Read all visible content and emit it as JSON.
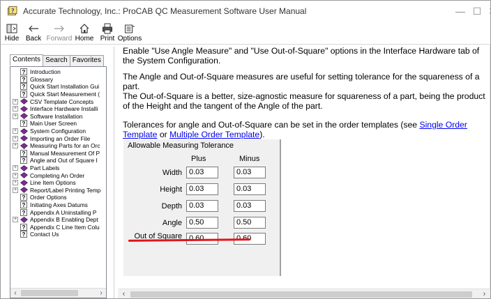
{
  "window": {
    "title": "Accurate Technology, Inc.: ProCAB QC Measurement Software User Manual",
    "minimize": "—",
    "maximize": "☐",
    "close": "✕"
  },
  "toolbar": {
    "hide": "Hide",
    "back": "Back",
    "forward": "Forward",
    "home": "Home",
    "print": "Print",
    "options": "Options"
  },
  "nav": {
    "tabs": [
      "Contents",
      "Search",
      "Favorites"
    ],
    "active_tab": "Contents",
    "tree": [
      {
        "type": "page",
        "label": "Introduction"
      },
      {
        "type": "page",
        "label": "Glossary"
      },
      {
        "type": "page",
        "label": "Quick Start Installation Gui"
      },
      {
        "type": "page",
        "label": "Quick Start Measurement ("
      },
      {
        "type": "book",
        "label": "CSV Template Concepts"
      },
      {
        "type": "book",
        "label": "Interface Hardware Installi"
      },
      {
        "type": "book",
        "label": "Software Installation"
      },
      {
        "type": "page",
        "label": "Main User Screen"
      },
      {
        "type": "book",
        "label": "System Configuration"
      },
      {
        "type": "book",
        "label": "Importing an Order File"
      },
      {
        "type": "book",
        "label": "Measuring Parts for an Orc"
      },
      {
        "type": "page",
        "label": "Manual Measurement Of P"
      },
      {
        "type": "page",
        "label": "Angle and Out of Square I"
      },
      {
        "type": "book",
        "label": "Part Labels"
      },
      {
        "type": "book",
        "label": "Completing An Order"
      },
      {
        "type": "book",
        "label": "Line Item Options"
      },
      {
        "type": "book",
        "label": "Report/Label Printing Temp"
      },
      {
        "type": "page",
        "label": "Order Options"
      },
      {
        "type": "page",
        "label": "Initiating Axes Datums"
      },
      {
        "type": "page",
        "label": "Appendix A  Uninstalling P"
      },
      {
        "type": "book",
        "label": "Appendix B  Enabling Dept"
      },
      {
        "type": "page",
        "label": "Appendix C  Line Item Colu"
      },
      {
        "type": "page",
        "label": "Contact Us"
      }
    ]
  },
  "content": {
    "para1": "Enable \"Use Angle Measure\" and \"Use Out-of-Square\" options in the Interface Hardware tab of the System Configuration.",
    "para2": "The Angle and Out-of-Square measures are useful for setting tolerance for the squareness of a part.",
    "para3": "The Out-of-Square is  a better, size-agnostic measure for squareness of a part, being the product of the Height and the tangent of the Angle of the part.",
    "para4_prefix": "Tolerances for angle and Out-of-Square can be set in the order templates (see ",
    "link1": "Single Order Template",
    "para4_mid": " or ",
    "link2": "Multiple Order Template",
    "para4_suffix": ")."
  },
  "tolerance": {
    "title": "Allowable Measuring Tolerance",
    "col_plus": "Plus",
    "col_minus": "Minus",
    "rows": [
      {
        "label": "Width",
        "plus": "0.03",
        "minus": "0.03"
      },
      {
        "label": "Height",
        "plus": "0.03",
        "minus": "0.03"
      },
      {
        "label": "Depth",
        "plus": "0.03",
        "minus": "0.03"
      },
      {
        "label": "Angle",
        "plus": "0.50",
        "minus": "0.50"
      },
      {
        "label": "Out of Square",
        "plus": "0.60",
        "minus": "0.60"
      }
    ],
    "highlight_color": "#e0151b"
  },
  "colors": {
    "link": "#0000ee",
    "book_icon": "#7b2d8e"
  }
}
